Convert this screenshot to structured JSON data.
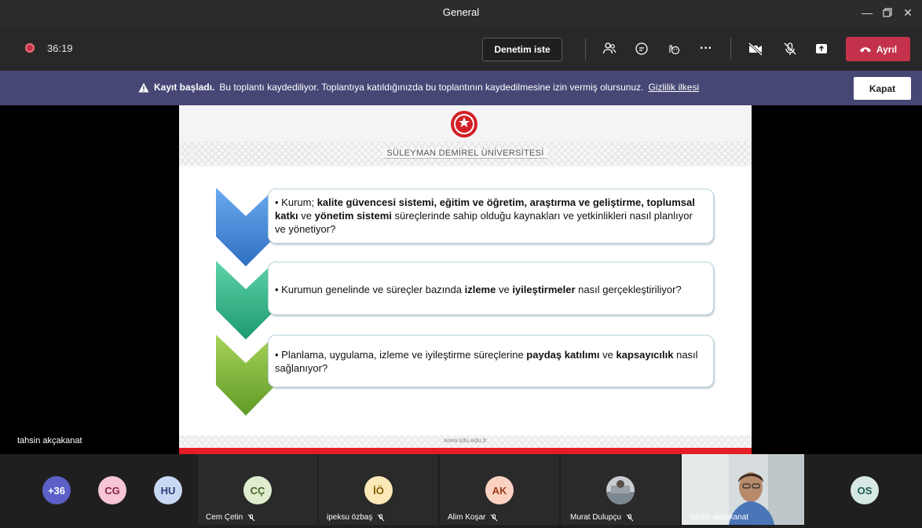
{
  "window": {
    "title": "General"
  },
  "toolbar": {
    "timer": "36:19",
    "request_control_label": "Denetim iste",
    "leave_label": "Ayrıl"
  },
  "banner": {
    "bold": "Kayıt başladı.",
    "message": "Bu toplantı kaydediliyor. Toplantıya katıldığınızda bu toplantının kaydedilmesine izin vermiş olursunuz.",
    "link": "Gizlilik ilkesi",
    "close_label": "Kapat"
  },
  "slide": {
    "university": "SÜLEYMAN DEMİREL ÜNİVERSİTESİ",
    "footer_url": "www.sdu.edu.tr",
    "items": [
      {
        "p1": "• Kurum; ",
        "b1": "kalite güvencesi sistemi, eğitim ve öğretim, araştırma ve geliştirme, toplumsal katkı",
        "p2": " ve ",
        "b2": "yönetim sistemi",
        "p3": " süreçlerinde sahip olduğu kaynakları ve yetkinlikleri nasıl planlıyor ve yönetiyor?"
      },
      {
        "p1": "• Kurumun genelinde ve süreçler bazında ",
        "b1": "izleme",
        "p2": " ve ",
        "b2": "iyileştirmeler",
        "p3": " nasıl gerçekleştiriliyor?"
      },
      {
        "p1": "• Planlama, uygulama, izleme ve iyileştirme süreçlerine ",
        "b1": "paydaş katılımı",
        "p2": " ve ",
        "b2": "kapsayıcılık",
        "p3": " nasıl sağlanıyor?"
      }
    ]
  },
  "presenter": {
    "name": "tahsin akçakanat"
  },
  "participants": {
    "overflow": "+36",
    "small": [
      {
        "initials": "CG"
      },
      {
        "initials": "HU"
      }
    ],
    "tiles": [
      {
        "initials": "CÇ",
        "name": "Cem Çetin"
      },
      {
        "initials": "İÖ",
        "name": "ipeksu özbaş"
      },
      {
        "initials": "AK",
        "name": "Alim Koşar"
      },
      {
        "initials": "",
        "name": "Murat Dulupçu"
      },
      {
        "initials": "",
        "name": "tahsin akçakanat"
      }
    ],
    "last": {
      "initials": "OS"
    }
  },
  "colors": {
    "accent": "#464775",
    "leave": "#c4314b",
    "blue_chevron": "#4a90d9",
    "green_chevron": "#2fb38a",
    "lime_chevron": "#7ab33a"
  }
}
